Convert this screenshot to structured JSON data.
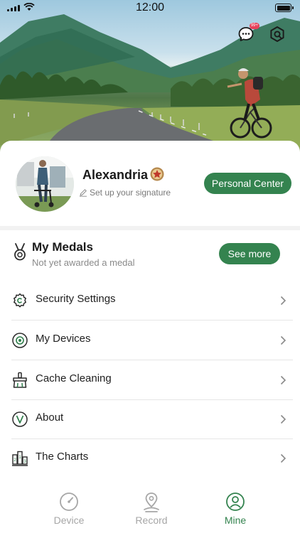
{
  "status_bar": {
    "time": "12:00"
  },
  "header": {
    "message_badge": "99+"
  },
  "profile": {
    "name": "Alexandria",
    "signature_placeholder": "Set up your signature",
    "personal_center_label": "Personal Center"
  },
  "medals": {
    "title": "My Medals",
    "subtitle": "Not yet awarded a medal",
    "see_more_label": "See more"
  },
  "menu": [
    {
      "label": "Security Settings",
      "icon": "security-settings-icon"
    },
    {
      "label": "My Devices",
      "icon": "my-devices-icon"
    },
    {
      "label": "Cache Cleaning",
      "icon": "cache-cleaning-icon"
    },
    {
      "label": "About",
      "icon": "about-icon"
    },
    {
      "label": "The Charts",
      "icon": "charts-icon"
    }
  ],
  "tabs": [
    {
      "label": "Device",
      "icon": "gauge-icon",
      "active": false
    },
    {
      "label": "Record",
      "icon": "location-pin-icon",
      "active": false
    },
    {
      "label": "Mine",
      "icon": "person-icon",
      "active": true
    }
  ],
  "colors": {
    "accent": "#34834f",
    "badge": "#e8425a",
    "muted_text": "#8a8a8a",
    "inactive_tab": "#a6a6a6"
  }
}
